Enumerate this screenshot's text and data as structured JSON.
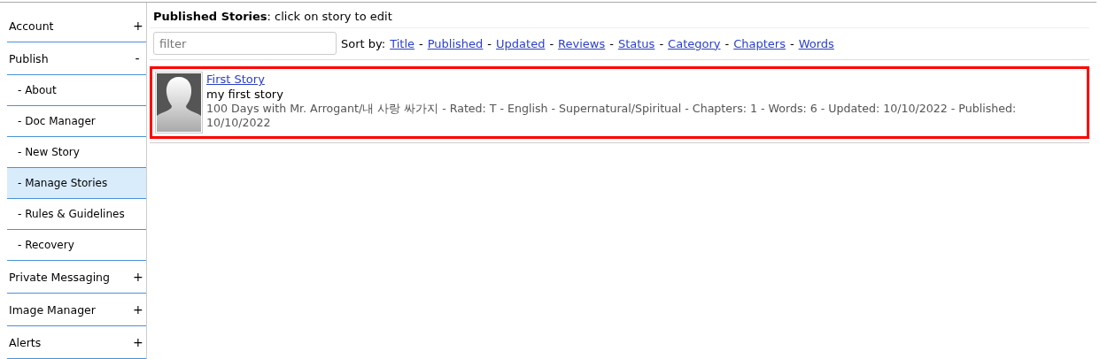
{
  "sidebar": {
    "items": [
      {
        "label": "Account",
        "toggle": "+",
        "sub": false,
        "selected": false
      },
      {
        "label": "Publish",
        "toggle": "-",
        "sub": false,
        "selected": false
      },
      {
        "label": "- About",
        "sub": true,
        "selected": false
      },
      {
        "label": "- Doc Manager",
        "sub": true,
        "selected": false
      },
      {
        "label": "- New Story",
        "sub": true,
        "selected": false
      },
      {
        "label": "- Manage Stories",
        "sub": true,
        "selected": true
      },
      {
        "label": "- Rules & Guidelines",
        "sub": true,
        "selected": false
      },
      {
        "label": "- Recovery",
        "sub": true,
        "selected": false
      },
      {
        "label": "Private Messaging",
        "toggle": "+",
        "sub": false,
        "selected": false
      },
      {
        "label": "Image Manager",
        "toggle": "+",
        "sub": false,
        "selected": false
      },
      {
        "label": "Alerts",
        "toggle": "+",
        "sub": false,
        "selected": false
      }
    ]
  },
  "heading": "**Published Stories**: click on story to edit",
  "filter": {
    "placeholder": "filter"
  },
  "sort": {
    "label": "Sort by:",
    "separator": "-",
    "options": [
      "Title",
      "Published",
      "Updated",
      "Reviews",
      "Status",
      "Category",
      "Chapters",
      "Words"
    ]
  },
  "stories": [
    {
      "title": "First Story",
      "summary": "my first story",
      "details": "100 Days with Mr. Arrogant/내 사랑 싸가지 - Rated: T - English - Supernatural/Spiritual - Chapters: 1 - Words: 6 - Updated: 10/10/2022 - Published: 10/10/2022",
      "highlighted": true
    }
  ]
}
